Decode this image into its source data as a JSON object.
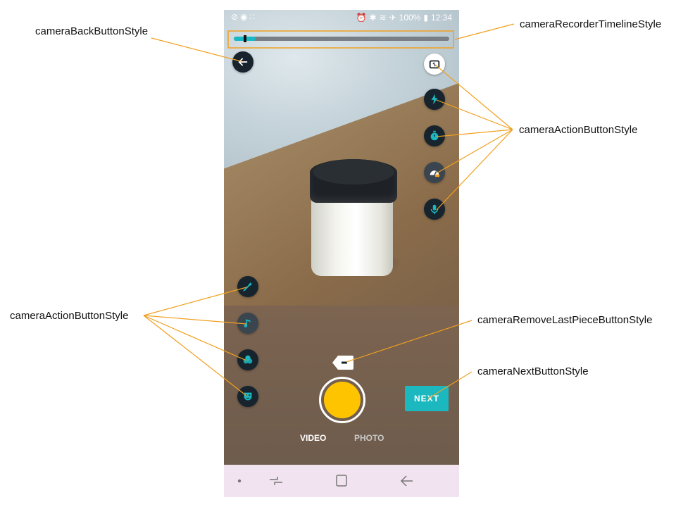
{
  "annotations": {
    "back_button": "cameraBackButtonStyle",
    "timeline": "cameraRecorderTimelineStyle",
    "action_right": "cameraActionButtonStyle",
    "action_left": "cameraActionButtonStyle",
    "remove_last": "cameraRemoveLastPieceButtonStyle",
    "next": "cameraNextButtonStyle"
  },
  "statusbar": {
    "battery": "100%",
    "time": "12:34"
  },
  "timeline": {
    "progress": 0.1
  },
  "buttons": {
    "next_label": "NEXT"
  },
  "modes": {
    "video": "VIDEO",
    "photo": "PHOTO"
  },
  "colors": {
    "accent": "#1cb8c0",
    "capture": "#ffc400",
    "button_bg": "#17242e",
    "callout_line": "#f0a020",
    "navbar": "#f1e3ef"
  },
  "icons": {
    "right_column": [
      "switch-camera-icon",
      "flash-icon",
      "timer-icon",
      "speed-off-icon",
      "microphone-icon"
    ],
    "left_column": [
      "magic-wand-icon",
      "music-note-icon",
      "filters-icon",
      "face-mask-icon"
    ]
  }
}
